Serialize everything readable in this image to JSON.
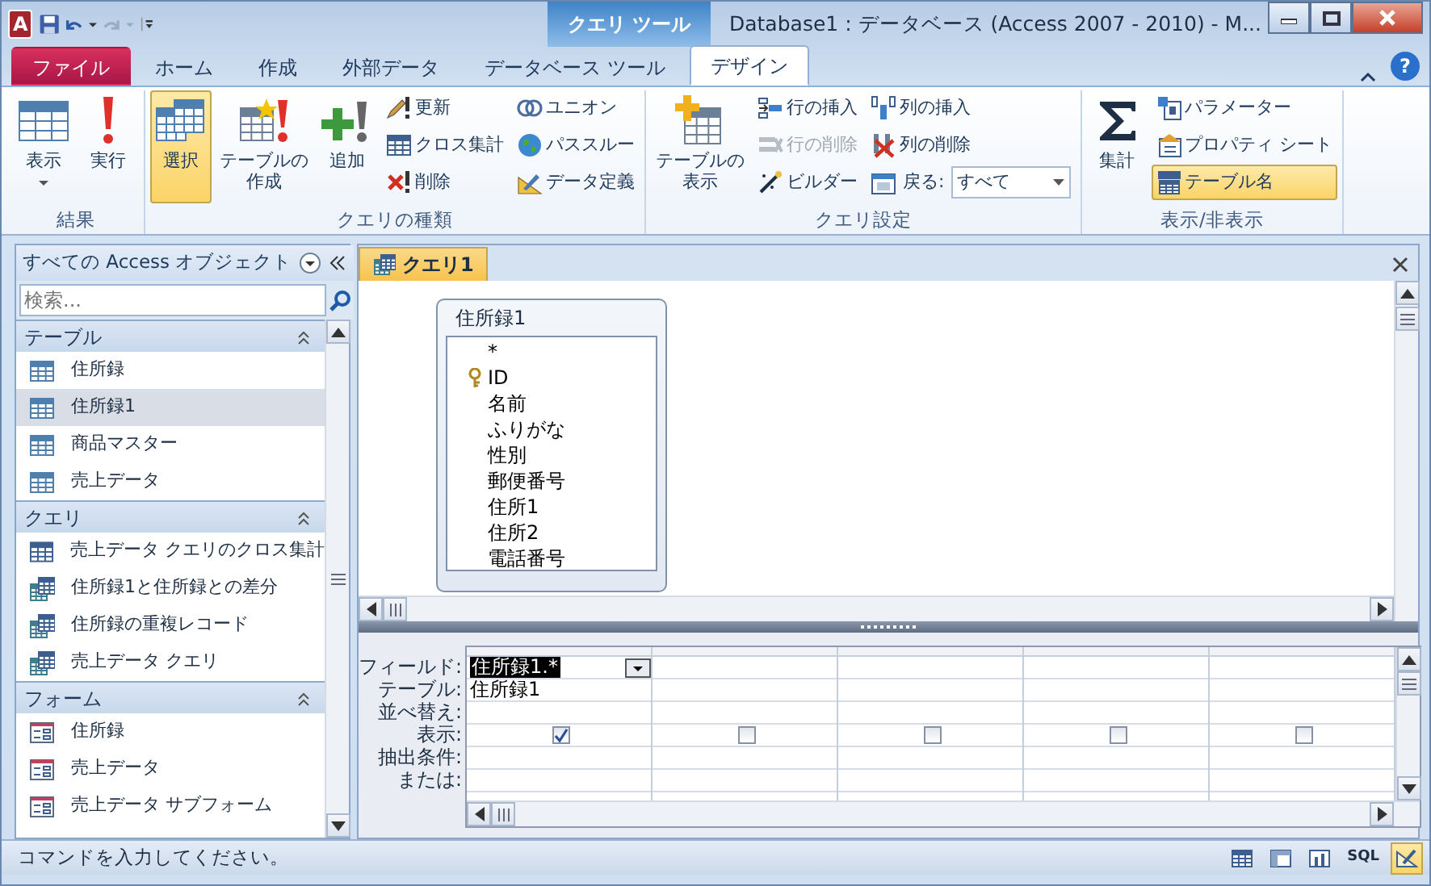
{
  "window": {
    "app_icon": "A",
    "context_tab": "クエリ ツール",
    "title": "Database1 : データベース (Access 2007 - 2010) - M...",
    "help": "?"
  },
  "ribbon_tabs": [
    {
      "label": "ファイル",
      "kind": "file",
      "selected": false
    },
    {
      "label": "ホーム",
      "kind": "tab",
      "selected": false
    },
    {
      "label": "作成",
      "kind": "tab",
      "selected": false
    },
    {
      "label": "外部データ",
      "kind": "tab",
      "selected": false
    },
    {
      "label": "データベース ツール",
      "kind": "tab",
      "selected": false
    },
    {
      "label": "デザイン",
      "kind": "tab",
      "selected": true
    }
  ],
  "ribbon_groups": [
    {
      "label": "結果",
      "controls": [
        {
          "kind": "large",
          "lines": [
            "表示"
          ],
          "dropdown": true,
          "selected": false
        },
        {
          "kind": "large",
          "lines": [
            "実行"
          ],
          "selected": false
        }
      ]
    },
    {
      "label": "クエリの種類",
      "controls": [
        {
          "kind": "large",
          "lines": [
            "選択"
          ],
          "selected": true
        },
        {
          "kind": "large",
          "lines": [
            "テーブルの",
            "作成"
          ],
          "selected": false
        },
        {
          "kind": "large",
          "lines": [
            "追加"
          ],
          "selected": false
        },
        {
          "kind": "column",
          "items": [
            {
              "kind": "small",
              "label": "更新",
              "disabled": false,
              "selected": false
            },
            {
              "kind": "small",
              "label": "クロス集計",
              "disabled": false,
              "selected": false
            },
            {
              "kind": "small",
              "label": "削除",
              "disabled": false,
              "selected": false
            }
          ]
        },
        {
          "kind": "column",
          "items": [
            {
              "kind": "small",
              "label": "ユニオン",
              "disabled": false,
              "selected": false
            },
            {
              "kind": "small",
              "label": "パススルー",
              "disabled": false,
              "selected": false
            },
            {
              "kind": "small",
              "label": "データ定義",
              "disabled": false,
              "selected": false
            }
          ]
        }
      ]
    },
    {
      "label": "クエリ設定",
      "controls": [
        {
          "kind": "large",
          "lines": [
            "テーブルの",
            "表示"
          ],
          "selected": false
        },
        {
          "kind": "column",
          "items": [
            {
              "kind": "small",
              "label": "行の挿入",
              "disabled": false,
              "selected": false
            },
            {
              "kind": "small",
              "label": "行の削除",
              "disabled": true,
              "selected": false
            },
            {
              "kind": "small",
              "label": "ビルダー",
              "disabled": false,
              "selected": false
            }
          ]
        },
        {
          "kind": "column",
          "items": [
            {
              "kind": "small",
              "label": "列の挿入",
              "disabled": false,
              "selected": false
            },
            {
              "kind": "small",
              "label": "列の削除",
              "disabled": false,
              "selected": false
            },
            {
              "kind": "select",
              "label": "戻る:",
              "value": "すべて"
            }
          ]
        }
      ]
    },
    {
      "label": "表示/非表示",
      "controls": [
        {
          "kind": "large",
          "lines": [
            "集計"
          ],
          "selected": false
        },
        {
          "kind": "column",
          "items": [
            {
              "kind": "small",
              "label": "パラメーター",
              "disabled": false,
              "selected": false
            },
            {
              "kind": "small",
              "label": "プロパティ シート",
              "disabled": false,
              "selected": false
            },
            {
              "kind": "small",
              "label": "テーブル名",
              "disabled": false,
              "selected": true
            }
          ]
        }
      ]
    }
  ],
  "nav_pane": {
    "header": "すべての Access オブジェクト",
    "search": {
      "placeholder": "検索..."
    },
    "groups": [
      {
        "label": "テーブル",
        "items": [
          {
            "label": "住所録",
            "kind": "table",
            "selected": false
          },
          {
            "label": "住所録1",
            "kind": "table",
            "selected": true
          },
          {
            "label": "商品マスター",
            "kind": "table",
            "selected": false
          },
          {
            "label": "売上データ",
            "kind": "table",
            "selected": false
          }
        ]
      },
      {
        "label": "クエリ",
        "items": [
          {
            "label": "売上データ クエリのクロス集計",
            "kind": "crosstab",
            "selected": false
          },
          {
            "label": "住所録1と住所録との差分",
            "kind": "query",
            "selected": false
          },
          {
            "label": "住所録の重複レコード",
            "kind": "query",
            "selected": false
          },
          {
            "label": "売上データ クエリ",
            "kind": "query",
            "selected": false
          }
        ]
      },
      {
        "label": "フォーム",
        "items": [
          {
            "label": "住所録",
            "kind": "form",
            "selected": false
          },
          {
            "label": "売上データ",
            "kind": "form",
            "selected": false
          },
          {
            "label": "売上データ サブフォーム",
            "kind": "form",
            "selected": false
          }
        ]
      }
    ]
  },
  "document": {
    "tab": "クエリ1",
    "table_box": {
      "title": "住所録1",
      "fields": [
        {
          "label": "*",
          "key": false
        },
        {
          "label": "ID",
          "key": true
        },
        {
          "label": "名前",
          "key": false
        },
        {
          "label": "ふりがな",
          "key": false
        },
        {
          "label": "性別",
          "key": false
        },
        {
          "label": "郵便番号",
          "key": false
        },
        {
          "label": "住所1",
          "key": false
        },
        {
          "label": "住所2",
          "key": false
        },
        {
          "label": "電話番号",
          "key": false
        }
      ]
    },
    "grid": {
      "row_labels": [
        "フィールド:",
        "テーブル:",
        "並べ替え:",
        "表示:",
        "抽出条件:",
        "または:"
      ],
      "columns": [
        {
          "field": "住所録1.*",
          "table": "住所録1",
          "show": true,
          "selected": true
        },
        {
          "show": false,
          "selected": false
        },
        {
          "show": false,
          "selected": false
        },
        {
          "show": false,
          "selected": false
        },
        {
          "show": false,
          "selected": false
        }
      ]
    }
  },
  "status_bar": {
    "text": "コマンドを入力してください。",
    "views": [
      {
        "kind": "datasheet",
        "selected": false
      },
      {
        "kind": "pivot_table",
        "selected": false
      },
      {
        "kind": "pivot_chart",
        "selected": false
      },
      {
        "kind": "sql",
        "label": "SQL",
        "selected": false
      },
      {
        "kind": "design",
        "selected": true
      }
    ]
  }
}
